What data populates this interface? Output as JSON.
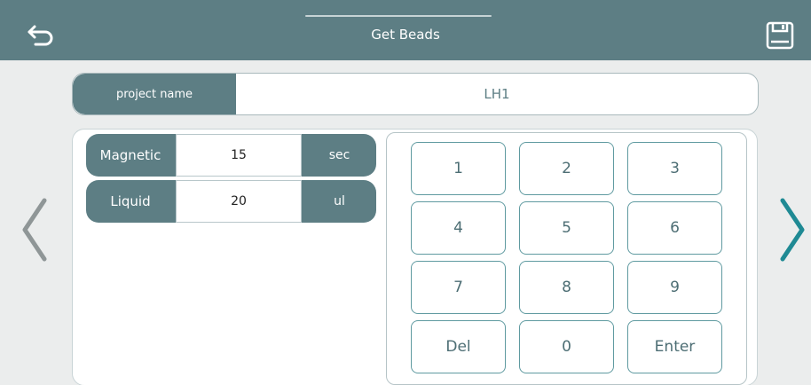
{
  "header": {
    "title": "Get Beads"
  },
  "project": {
    "label": "project name",
    "value": "LH1"
  },
  "params": [
    {
      "label": "Magnetic",
      "value": "15",
      "unit": "sec"
    },
    {
      "label": "Liquid",
      "value": "20",
      "unit": "ul"
    }
  ],
  "keypad": {
    "keys": [
      "1",
      "2",
      "3",
      "4",
      "5",
      "6",
      "7",
      "8",
      "9",
      "Del",
      "0",
      "Enter"
    ]
  },
  "colors": {
    "primary": "#5d7e84",
    "accent": "#1f8a94",
    "background": "#ebeded"
  },
  "icons": {
    "back": "back-arrow-icon",
    "save": "save-icon",
    "prev": "chevron-left-icon",
    "next": "chevron-right-icon"
  }
}
